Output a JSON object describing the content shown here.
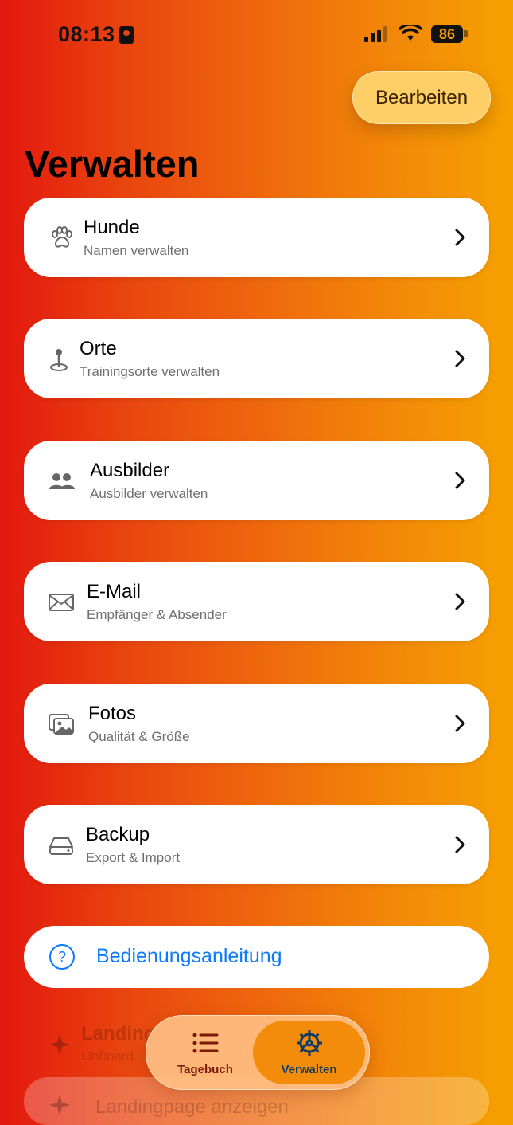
{
  "status_bar": {
    "time": "08:13",
    "battery": "86"
  },
  "header": {
    "edit_label": "Bearbeiten",
    "title": "Verwalten"
  },
  "items": [
    {
      "title": "Hunde",
      "subtitle": "Namen verwalten",
      "icon": "paw-icon"
    },
    {
      "title": "Orte",
      "subtitle": "Trainingsorte verwalten",
      "icon": "map-pin-icon"
    },
    {
      "title": "Ausbilder",
      "subtitle": "Ausbilder verwalten",
      "icon": "people-icon"
    },
    {
      "title": "E-Mail",
      "subtitle": "Empfänger & Absender",
      "icon": "envelope-icon"
    },
    {
      "title": "Fotos",
      "subtitle": "Qualität & Größe",
      "icon": "photos-icon"
    },
    {
      "title": "Backup",
      "subtitle": "Export & Import",
      "icon": "drive-icon"
    }
  ],
  "help": {
    "label": "Bedienungsanleitung",
    "icon": "question-circle-icon"
  },
  "hidden_rows": [
    {
      "title": "Landing",
      "subtitle": "Onboard"
    },
    {
      "title": "Landingpage anzeigen"
    }
  ],
  "tabbar": {
    "tabs": [
      {
        "label": "Tagebuch",
        "icon": "list-icon"
      },
      {
        "label": "Verwalten",
        "icon": "gear-icon",
        "selected": true
      }
    ]
  },
  "colors": {
    "accent": "#0a7aff",
    "edit_button": "#fecf66",
    "tab_selected": "#f28c0a"
  }
}
